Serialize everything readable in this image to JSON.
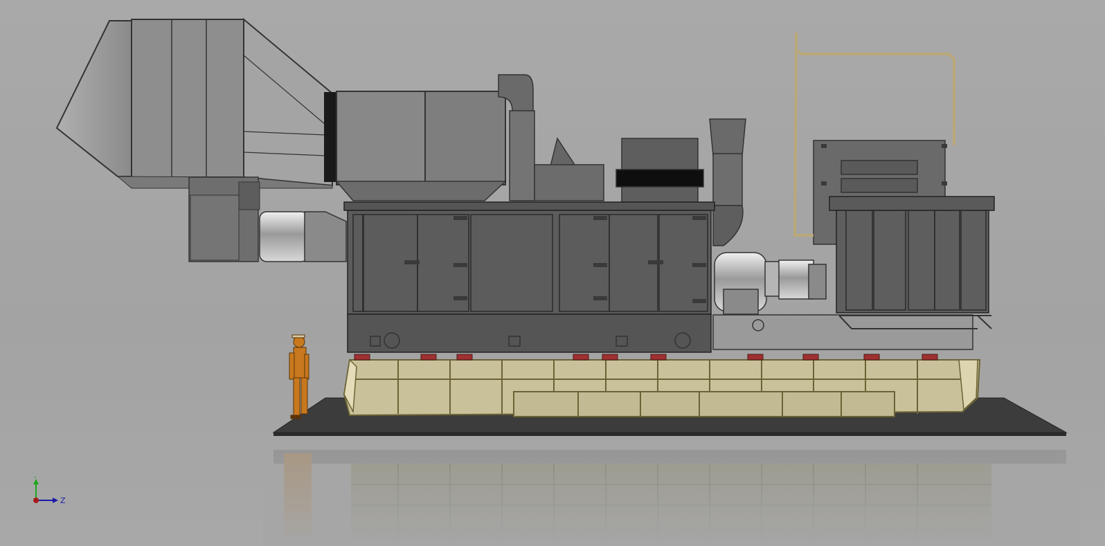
{
  "viewport": {
    "background_color": "#a6a6a6"
  },
  "model": {
    "description_icon": "gas-turbine-generator-package-model",
    "colors": {
      "enclosure": "#5e5e5e",
      "enclosure_dark": "#4a4a4a",
      "duct": "#8c8c8c",
      "duct_light": "#a0a0a0",
      "skid": "#c9c19a",
      "skid_edge": "#6b6335",
      "mounts": "#a03030",
      "ground": "#3a3a3a",
      "person": "#c8781e",
      "pipe": "#b9a878"
    }
  },
  "triad": {
    "y_label": "Y",
    "z_label": "Z",
    "y_color": "#1aa81a",
    "z_color": "#1a1aa8",
    "origin_color": "#a81a1a"
  }
}
